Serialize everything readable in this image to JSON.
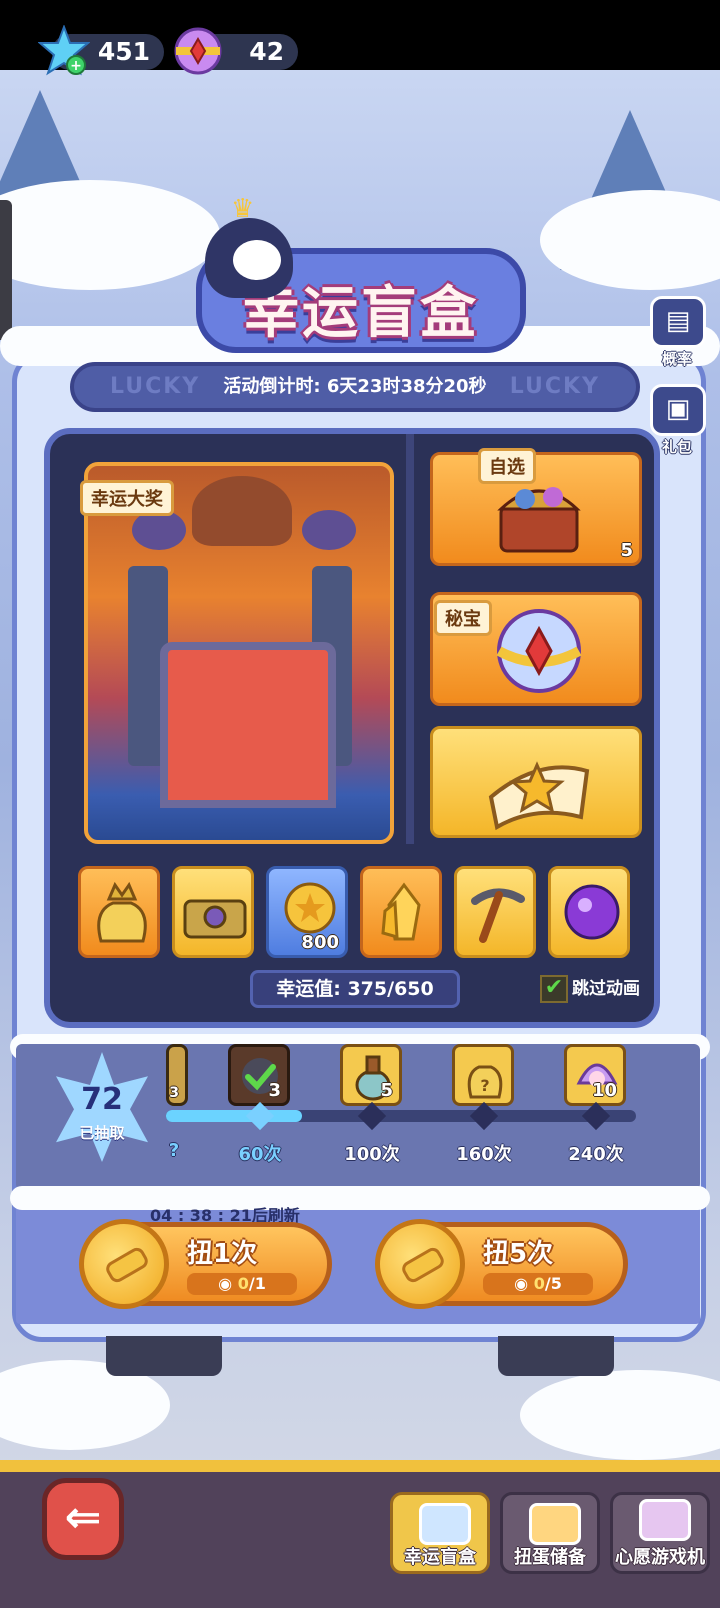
{
  "resources": [
    {
      "icon": "blue-crystal-plus-icon",
      "value": "451"
    },
    {
      "icon": "gem-orb-icon",
      "value": "42"
    }
  ],
  "banner": {
    "title": "幸运盲盒",
    "decor_text": "LUCKY"
  },
  "countdown": {
    "text": "活动倒计时: 6天23时38分20秒"
  },
  "side_buttons": [
    {
      "icon": "document-icon",
      "label": "概率"
    },
    {
      "icon": "gift-chest-icon",
      "label": "礼包"
    }
  ],
  "grand_prize": {
    "tag": "幸运大奖"
  },
  "right_slots": [
    {
      "tag": "自选",
      "count": "5",
      "icon": "treasure-chest-icon"
    },
    {
      "tag": "秘宝",
      "count": "",
      "icon": "jewel-orb-icon"
    },
    {
      "tag": "",
      "count": "",
      "icon": "star-scroll-icon"
    }
  ],
  "bottom_slots": [
    {
      "icon": "crown-bag-icon",
      "count": ""
    },
    {
      "icon": "gold-chest-icon",
      "count": ""
    },
    {
      "icon": "coin-icon",
      "count": "800"
    },
    {
      "icon": "crystal-icon",
      "count": ""
    },
    {
      "icon": "pickaxe-icon",
      "count": ""
    },
    {
      "icon": "purple-orb-icon",
      "count": ""
    }
  ],
  "luck": {
    "text": "幸运值: 375/650",
    "value": 375,
    "max": 650
  },
  "skip_animation": {
    "label": "跳过动画",
    "checked": true
  },
  "draws": {
    "count": "72",
    "label": "已抽取"
  },
  "progress": {
    "fraction": 0.29,
    "milestones": [
      {
        "label": "60次",
        "count": "3",
        "claimed": true
      },
      {
        "label": "100次",
        "count": "5",
        "claimed": false
      },
      {
        "label": "160次",
        "count": "",
        "claimed": false
      },
      {
        "label": "240次",
        "count": "10",
        "claimed": false
      }
    ],
    "partial_left": {
      "count": "3"
    }
  },
  "refresh": {
    "text": "04 : 38 : 21后刷新"
  },
  "spin1": {
    "label": "扭1次",
    "cost_used": "0",
    "cost_total": "/1"
  },
  "spin5": {
    "label": "扭5次",
    "cost_used": "0",
    "cost_total": "/5"
  },
  "nav": [
    {
      "label": "幸运盲盒",
      "active": true
    },
    {
      "label": "扭蛋储备",
      "active": false
    },
    {
      "label": "心愿游戏机",
      "active": false
    }
  ],
  "colors": {
    "accent_orange": "#f18b1d",
    "panel_blue": "#6f83d2",
    "track_fill": "#6bd3ff"
  }
}
